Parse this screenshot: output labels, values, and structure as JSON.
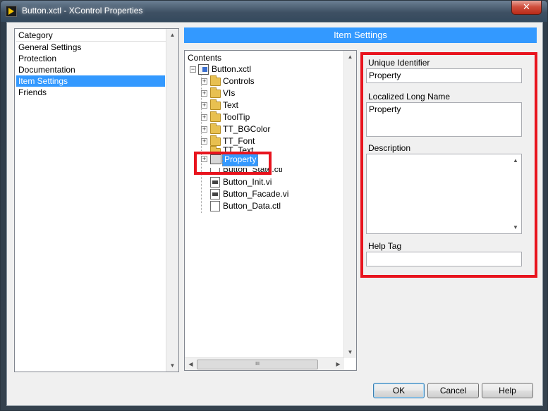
{
  "window": {
    "title": "Button.xctl - XControl Properties",
    "close_label": "✕"
  },
  "category": {
    "header": "Category",
    "items": [
      "General Settings",
      "Protection",
      "Documentation",
      "Item Settings",
      "Friends"
    ],
    "selected": "Item Settings"
  },
  "item_settings": {
    "header": "Item Settings"
  },
  "contents": {
    "header": "Contents",
    "root": "Button.xctl",
    "nodes": [
      "Controls",
      "VIs",
      "Text",
      "ToolTip",
      "TT_BGColor",
      "TT_Font",
      "TT_Text",
      "Property",
      "Button_State.ctl",
      "Button_Init.vi",
      "Button_Facade.vi",
      "Button_Data.ctl"
    ],
    "selected": "Property",
    "scroll_thumb": "III"
  },
  "fields": {
    "unique_identifier": {
      "label": "Unique Identifier",
      "value": "Property"
    },
    "localized_long_name": {
      "label": "Localized Long Name",
      "value": "Property"
    },
    "description": {
      "label": "Description",
      "value": ""
    },
    "help_tag": {
      "label": "Help Tag",
      "value": ""
    }
  },
  "buttons": {
    "ok": "OK",
    "cancel": "Cancel",
    "help": "Help"
  },
  "colors": {
    "selection": "#3399ff",
    "highlight_box": "#e8141e"
  }
}
